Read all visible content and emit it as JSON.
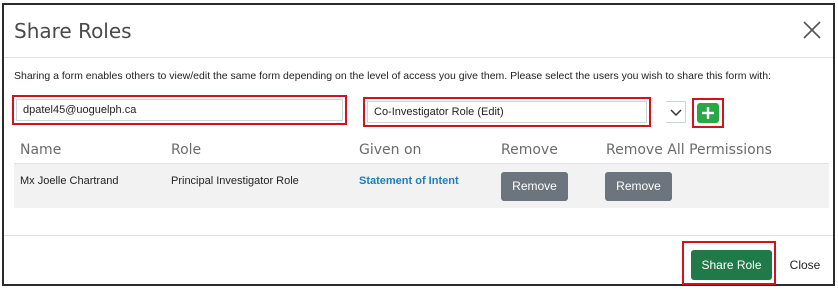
{
  "dialog": {
    "title": "Share Roles",
    "close_icon": "close-icon"
  },
  "intro_text": "Sharing a form enables others to view/edit the same form depending on the level of access you give them. Please select the users you wish to share this form with:",
  "form": {
    "user_value": "dpatel45@uoguelph.ca",
    "role_value": "Co-Investigator Role (Edit)",
    "add_icon": "plus-icon"
  },
  "table": {
    "headers": [
      "Name",
      "Role",
      "Given on",
      "Remove",
      "Remove All Permissions"
    ],
    "rows": [
      {
        "name": "Mx Joelle Chartrand",
        "role": "Principal Investigator Role",
        "given_on": "Statement of Intent",
        "remove_label": "Remove",
        "remove_all_label": "Remove"
      }
    ]
  },
  "footer": {
    "share_label": "Share Role",
    "close_label": "Close"
  },
  "colors": {
    "highlight": "#d4121e",
    "primary": "#1f7a47",
    "add": "#28a745",
    "secondary": "#6c757d",
    "link": "#1a7fc1"
  }
}
